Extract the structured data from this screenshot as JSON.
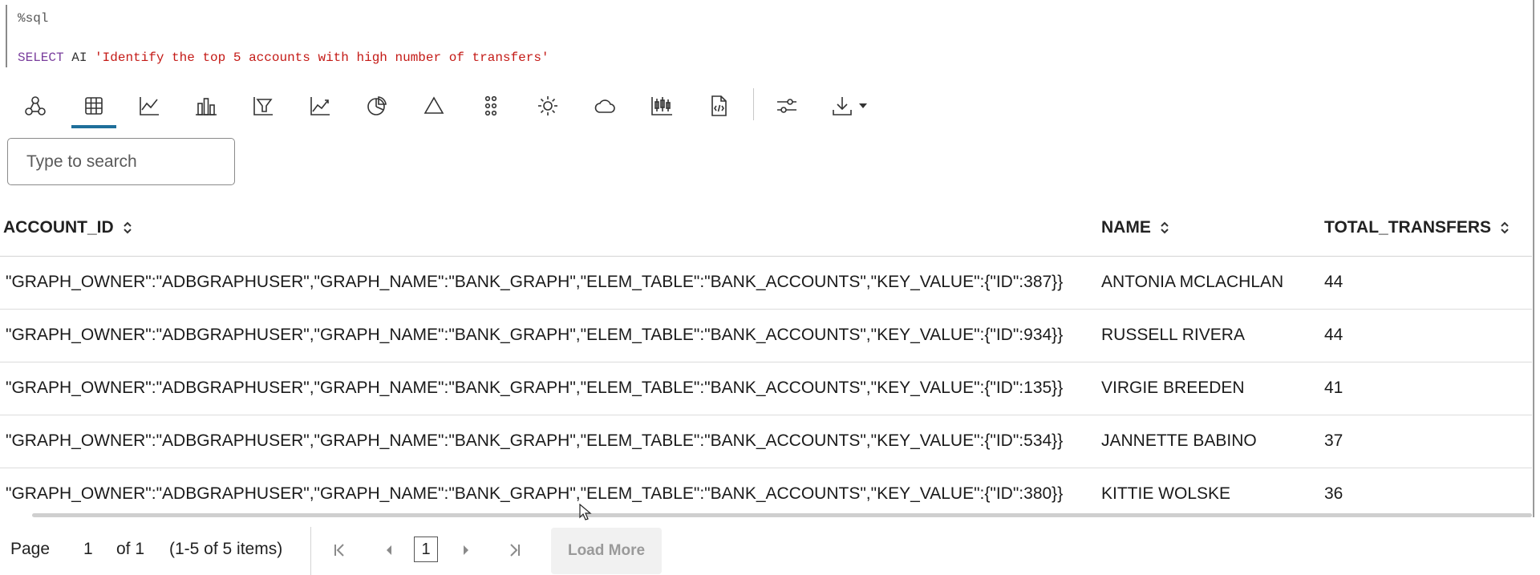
{
  "editor": {
    "line1": "%sql",
    "line2_keyword1": "SELECT",
    "line2_keyword2": "AI",
    "line2_string": "'Identify the top 5 accounts with high number of transfers'"
  },
  "toolbar": {
    "buttons": [
      {
        "icon": "graph-icon",
        "active": false
      },
      {
        "icon": "table-icon",
        "active": true
      },
      {
        "icon": "line-chart-icon",
        "active": false
      },
      {
        "icon": "bar-chart-icon",
        "active": false
      },
      {
        "icon": "funnel-chart-icon",
        "active": false
      },
      {
        "icon": "area-chart-icon",
        "active": false
      },
      {
        "icon": "pie-chart-icon",
        "active": false
      },
      {
        "icon": "pyramid-icon",
        "active": false
      },
      {
        "icon": "scatter-icon",
        "active": false
      },
      {
        "icon": "sunburst-icon",
        "active": false
      },
      {
        "icon": "cloud-icon",
        "active": false
      },
      {
        "icon": "boxplot-icon",
        "active": false
      },
      {
        "icon": "code-file-icon",
        "active": false
      },
      {
        "icon": "settings-sliders-icon",
        "active": false
      },
      {
        "icon": "download-icon",
        "active": false
      }
    ],
    "accent_color": "#1f6f9a"
  },
  "search": {
    "placeholder": "Type to search",
    "value": ""
  },
  "table": {
    "columns": [
      "ACCOUNT_ID",
      "NAME",
      "TOTAL_TRANSFERS"
    ],
    "rows": [
      [
        "\"GRAPH_OWNER\":\"ADBGRAPHUSER\",\"GRAPH_NAME\":\"BANK_GRAPH\",\"ELEM_TABLE\":\"BANK_ACCOUNTS\",\"KEY_VALUE\":{\"ID\":387}}",
        "ANTONIA MCLACHLAN",
        "44"
      ],
      [
        "\"GRAPH_OWNER\":\"ADBGRAPHUSER\",\"GRAPH_NAME\":\"BANK_GRAPH\",\"ELEM_TABLE\":\"BANK_ACCOUNTS\",\"KEY_VALUE\":{\"ID\":934}}",
        "RUSSELL RIVERA",
        "44"
      ],
      [
        "\"GRAPH_OWNER\":\"ADBGRAPHUSER\",\"GRAPH_NAME\":\"BANK_GRAPH\",\"ELEM_TABLE\":\"BANK_ACCOUNTS\",\"KEY_VALUE\":{\"ID\":135}}",
        "VIRGIE BREEDEN",
        "41"
      ],
      [
        "\"GRAPH_OWNER\":\"ADBGRAPHUSER\",\"GRAPH_NAME\":\"BANK_GRAPH\",\"ELEM_TABLE\":\"BANK_ACCOUNTS\",\"KEY_VALUE\":{\"ID\":534}}",
        "JANNETTE BABINO",
        "37"
      ],
      [
        "\"GRAPH_OWNER\":\"ADBGRAPHUSER\",\"GRAPH_NAME\":\"BANK_GRAPH\",\"ELEM_TABLE\":\"BANK_ACCOUNTS\",\"KEY_VALUE\":{\"ID\":380}}",
        "KITTIE WOLSKE",
        "36"
      ]
    ]
  },
  "pagination": {
    "page_label": "Page",
    "page_value": "1",
    "of_label": "of 1",
    "items_label": "(1-5 of 5 items)",
    "current_page": "1",
    "load_more_label": "Load More"
  }
}
